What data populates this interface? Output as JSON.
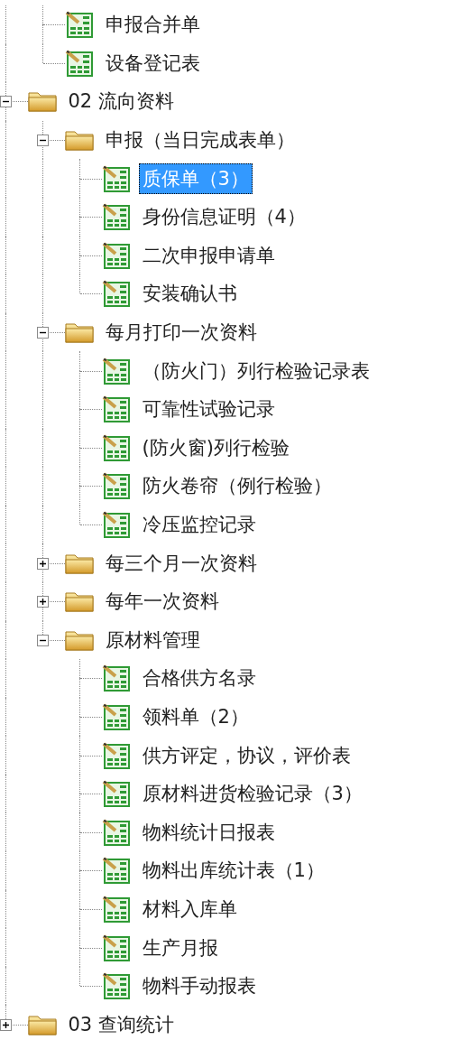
{
  "tree": [
    {
      "kind": "folder",
      "children": [
        {
          "kind": "document",
          "label": "申报合并单",
          "selected": false
        },
        {
          "kind": "document",
          "label": "设备登记表",
          "selected": false
        }
      ]
    },
    {
      "kind": "folder",
      "label": "02 流向资料",
      "expanded": true,
      "selected": false,
      "children": [
        {
          "kind": "folder",
          "label": "申报（当日完成表单）",
          "expanded": true,
          "selected": false,
          "children": [
            {
              "kind": "document",
              "label": "质保单（3）",
              "selected": true
            },
            {
              "kind": "document",
              "label": "身份信息证明（4）",
              "selected": false
            },
            {
              "kind": "document",
              "label": "二次申报申请单",
              "selected": false
            },
            {
              "kind": "document",
              "label": "安装确认书",
              "selected": false
            }
          ]
        },
        {
          "kind": "folder",
          "label": "每月打印一次资料",
          "expanded": true,
          "selected": false,
          "children": [
            {
              "kind": "document",
              "label": "（防火门）列行检验记录表",
              "selected": false
            },
            {
              "kind": "document",
              "label": "可靠性试验记录",
              "selected": false
            },
            {
              "kind": "document",
              "label": "(防火窗)列行检验",
              "selected": false
            },
            {
              "kind": "document",
              "label": "防火卷帘（例行检验）",
              "selected": false
            },
            {
              "kind": "document",
              "label": "冷压监控记录",
              "selected": false
            }
          ]
        },
        {
          "kind": "folder",
          "label": "每三个月一次资料",
          "expanded": false,
          "selected": false
        },
        {
          "kind": "folder",
          "label": "每年一次资料",
          "expanded": false,
          "selected": false
        },
        {
          "kind": "folder",
          "label": "原材料管理",
          "expanded": true,
          "selected": false,
          "children": [
            {
              "kind": "document",
              "label": "合格供方名录",
              "selected": false
            },
            {
              "kind": "document",
              "label": "领料单（2）",
              "selected": false
            },
            {
              "kind": "document",
              "label": "供方评定，协议，评价表",
              "selected": false
            },
            {
              "kind": "document",
              "label": "原材料进货检验记录（3）",
              "selected": false
            },
            {
              "kind": "document",
              "label": "物料统计日报表",
              "selected": false
            },
            {
              "kind": "document",
              "label": "物料出库统计表（1）",
              "selected": false
            },
            {
              "kind": "document",
              "label": "材料入库单",
              "selected": false
            },
            {
              "kind": "document",
              "label": "生产月报",
              "selected": false
            },
            {
              "kind": "document",
              "label": "物料手动报表",
              "selected": false
            }
          ]
        }
      ]
    },
    {
      "kind": "folder",
      "label": "03 查询统计",
      "expanded": false,
      "selected": false
    }
  ]
}
